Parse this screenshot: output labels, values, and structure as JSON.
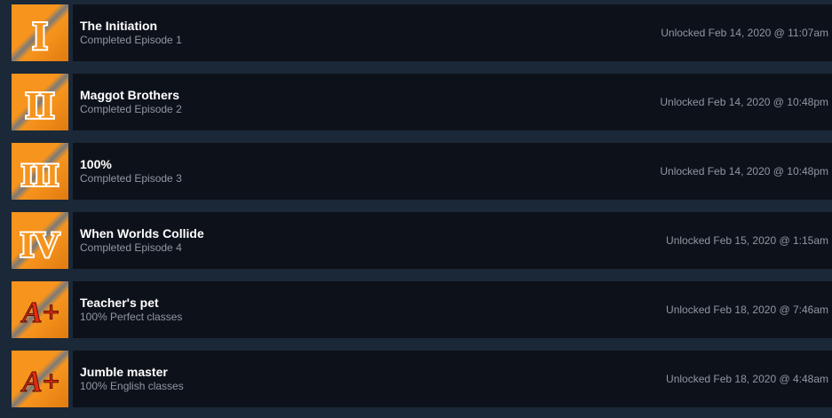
{
  "colors": {
    "page_bg": "#1b2838",
    "row_bg": "#0d111a",
    "title": "#ffffff",
    "muted": "#8f98a0",
    "icon_orange": "#f7941d",
    "icon_gray": "#7a7a7a",
    "grade_red": "#e8290f"
  },
  "achievements": [
    {
      "title": "The Initiation",
      "description": "Completed Episode 1",
      "unlocked": "Unlocked Feb 14, 2020 @ 11:07am",
      "icon": "numeral-i-icon",
      "icon_text": "I"
    },
    {
      "title": "Maggot Brothers",
      "description": "Completed Episode 2",
      "unlocked": "Unlocked Feb 14, 2020 @ 10:48pm",
      "icon": "numeral-ii-icon",
      "icon_text": "II"
    },
    {
      "title": "100%",
      "description": "Completed Episode 3",
      "unlocked": "Unlocked Feb 14, 2020 @ 10:48pm",
      "icon": "numeral-iii-icon",
      "icon_text": "III"
    },
    {
      "title": "When Worlds Collide",
      "description": "Completed Episode 4",
      "unlocked": "Unlocked Feb 15, 2020 @ 1:15am",
      "icon": "numeral-iv-icon",
      "icon_text": "IV"
    },
    {
      "title": "Teacher's pet",
      "description": "100% Perfect classes",
      "unlocked": "Unlocked Feb 18, 2020 @ 7:46am",
      "icon": "a-plus-grade-icon",
      "icon_text": "A+"
    },
    {
      "title": "Jumble master",
      "description": "100% English classes",
      "unlocked": "Unlocked Feb 18, 2020 @ 4:48am",
      "icon": "a-plus-grade-icon",
      "icon_text": "A+"
    }
  ]
}
